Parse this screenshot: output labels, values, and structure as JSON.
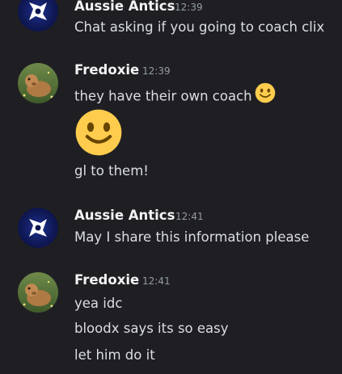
{
  "messages": [
    {
      "author": "Aussie Antics",
      "time": "12:39",
      "avatar_icon": "shuriken-logo-icon",
      "lines": [
        "Chat asking if you going to coach clix"
      ]
    },
    {
      "author": "Fredoxie",
      "time": "12:39",
      "avatar_icon": "dog-photo-avatar",
      "lines": [
        "they have their own coach",
        "gl to them!"
      ],
      "inline_emoji": "slightly-smiling-face-emoji",
      "jumbo_emoji": "slightly-smiling-face-emoji"
    },
    {
      "author": "Aussie Antics",
      "time": "12:41",
      "avatar_icon": "shuriken-logo-icon",
      "lines": [
        "May I share this information please"
      ]
    },
    {
      "author": "Fredoxie",
      "time": "12:41",
      "avatar_icon": "dog-photo-avatar",
      "lines": [
        "yea idc",
        "bloodx says its so easy",
        "let him do it"
      ]
    }
  ],
  "colors": {
    "background": "#1f1f23",
    "username": "#f2f3f5",
    "text": "#dbdee1",
    "timestamp": "#949ba4",
    "emoji_yellow": "#ffcc4d"
  }
}
